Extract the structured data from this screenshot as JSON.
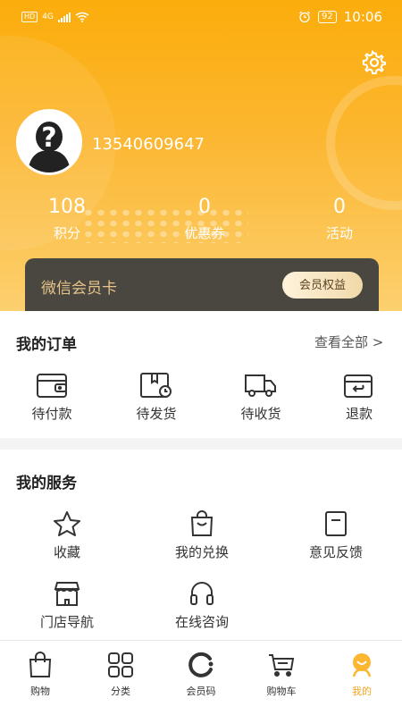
{
  "status_bar": {
    "hd": "HD",
    "network": "4G",
    "battery": "92",
    "time": "10:06"
  },
  "profile": {
    "phone": "13540609647",
    "stats": [
      {
        "value": "108",
        "label": "积分"
      },
      {
        "value": "0",
        "label": "优惠券"
      },
      {
        "value": "0",
        "label": "活动"
      }
    ]
  },
  "member_card": {
    "title": "微信会员卡",
    "benefits_button": "会员权益"
  },
  "orders": {
    "title": "我的订单",
    "view_all": "查看全部 >",
    "items": [
      {
        "label": "待付款",
        "icon": "wallet-icon"
      },
      {
        "label": "待发货",
        "icon": "package-clock-icon"
      },
      {
        "label": "待收货",
        "icon": "truck-icon"
      },
      {
        "label": "退款",
        "icon": "refund-icon"
      }
    ]
  },
  "services": {
    "title": "我的服务",
    "items": [
      {
        "label": "收藏",
        "icon": "star-icon"
      },
      {
        "label": "我的兑换",
        "icon": "shopping-bag-icon"
      },
      {
        "label": "意见反馈",
        "icon": "feedback-icon"
      },
      {
        "label": "门店导航",
        "icon": "store-icon"
      },
      {
        "label": "在线咨询",
        "icon": "headset-icon"
      }
    ]
  },
  "tabbar": {
    "items": [
      {
        "label": "购物",
        "icon": "bag-icon"
      },
      {
        "label": "分类",
        "icon": "grid-icon"
      },
      {
        "label": "会员码",
        "icon": "member-code-icon"
      },
      {
        "label": "购物车",
        "icon": "cart-icon"
      },
      {
        "label": "我的",
        "icon": "profile-icon"
      }
    ],
    "active_color": "#f5a623"
  },
  "colors": {
    "header_primary": "#fbad0b",
    "header_light": "#fcd06f",
    "card_dark": "#4a4640",
    "card_gold": "#e6c48a"
  }
}
